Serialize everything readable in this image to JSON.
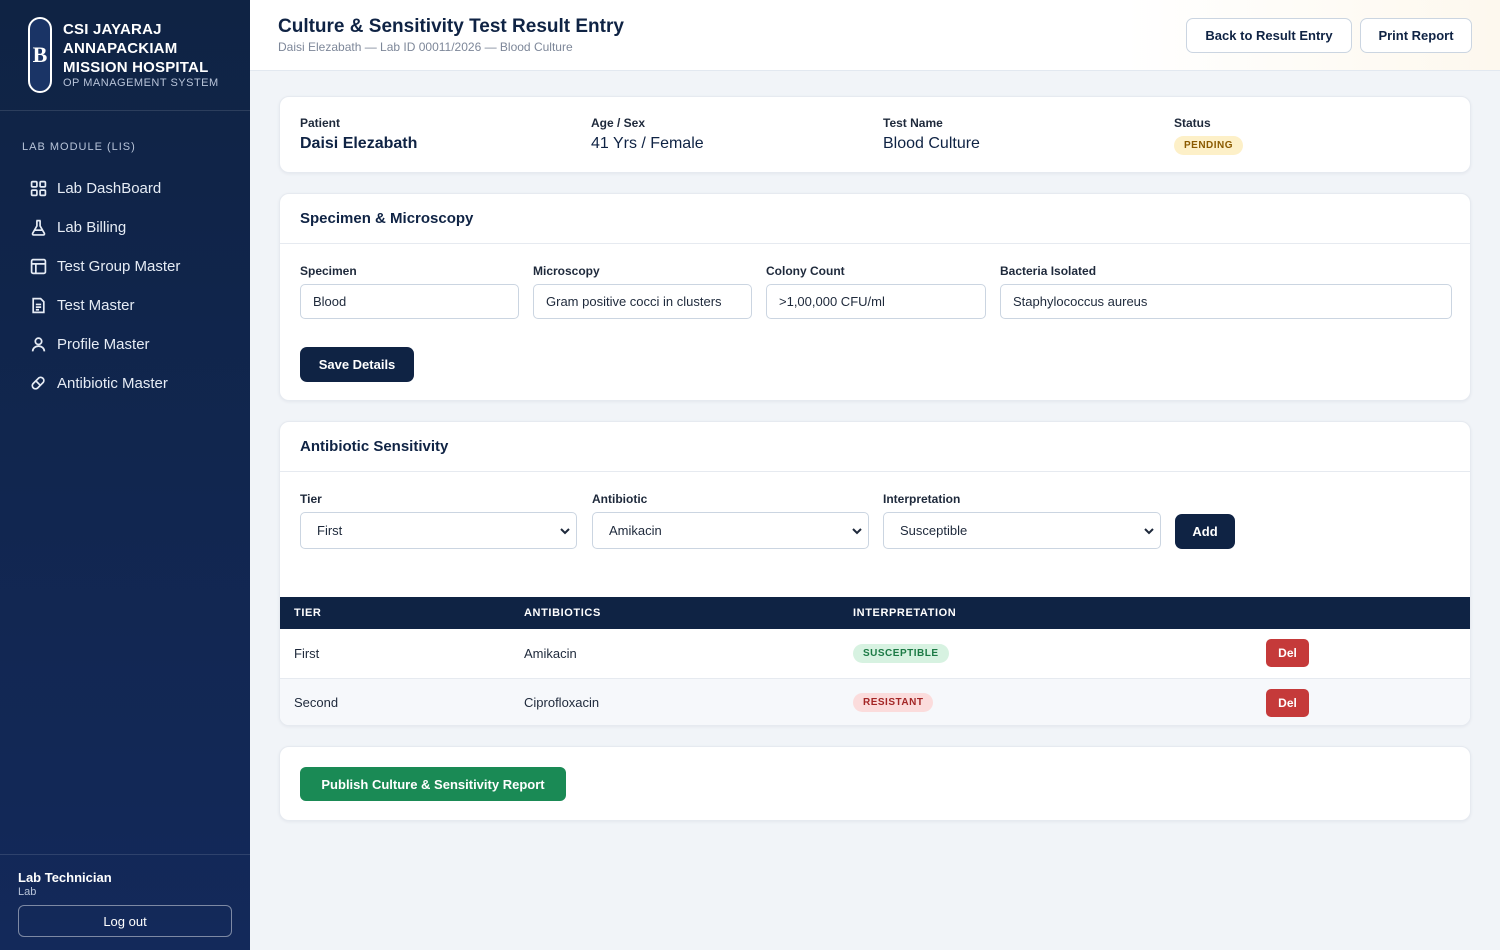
{
  "hospital": {
    "logo_letter": "B",
    "name_line1": "CSI JAYARAJ",
    "name_line2": "ANNAPACKIAM",
    "name_line3": "MISSION HOSPITAL",
    "subtitle": "OP MANAGEMENT SYSTEM"
  },
  "sidebar": {
    "module_label": "LAB MODULE (LIS)",
    "items": [
      {
        "label": "Lab DashBoard",
        "icon": "grid-icon"
      },
      {
        "label": "Lab Billing",
        "icon": "flask-icon"
      },
      {
        "label": "Test Group Master",
        "icon": "layout-icon"
      },
      {
        "label": "Test Master",
        "icon": "document-icon"
      },
      {
        "label": "Profile Master",
        "icon": "user-icon"
      },
      {
        "label": "Antibiotic Master",
        "icon": "pill-icon"
      }
    ],
    "user_role": "Lab Technician",
    "user_dept": "Lab",
    "logout_label": "Log out"
  },
  "header": {
    "title": "Culture & Sensitivity Test Result Entry",
    "subtitle": "Daisi Elezabath — Lab ID 00011/2026 — Blood Culture",
    "back_label": "Back to Result Entry",
    "print_label": "Print Report"
  },
  "patient_card": {
    "patient_label": "Patient",
    "patient_name": "Daisi Elezabath",
    "age_sex_label": "Age / Sex",
    "age_sex": "41 Yrs / Female",
    "test_label": "Test Name",
    "test_name": "Blood Culture",
    "status_label": "Status",
    "status": "PENDING"
  },
  "specimen": {
    "title": "Specimen & Microscopy",
    "specimen_label": "Specimen",
    "specimen_value": "Blood",
    "microscopy_label": "Microscopy",
    "microscopy_value": "Gram positive cocci in clusters",
    "colony_label": "Colony Count",
    "colony_value": ">1,00,000 CFU/ml",
    "bacteria_label": "Bacteria Isolated",
    "bacteria_value": "Staphylococcus aureus",
    "save_label": "Save Details"
  },
  "sensitivity": {
    "title": "Antibiotic Sensitivity",
    "tier_label": "Tier",
    "tier_value": "First",
    "antibiotic_label": "Antibiotic",
    "antibiotic_value": "Amikacin",
    "interpretation_label": "Interpretation",
    "interpretation_value": "Susceptible",
    "add_label": "Add",
    "columns": [
      "TIER",
      "ANTIBIOTICS",
      "INTERPRETATION",
      ""
    ],
    "rows": [
      {
        "tier": "First",
        "antibiotic": "Amikacin",
        "interpretation": "SUSCEPTIBLE",
        "action": "Del"
      },
      {
        "tier": "Second",
        "antibiotic": "Ciprofloxacin",
        "interpretation": "RESISTANT",
        "action": "Del"
      }
    ]
  },
  "publish": {
    "label": "Publish Culture & Sensitivity Report"
  },
  "colors": {
    "navy": "#0f2344",
    "green": "#1a8a55",
    "danger": "#c53a3a",
    "pending_bg": "#fdf0c8"
  }
}
